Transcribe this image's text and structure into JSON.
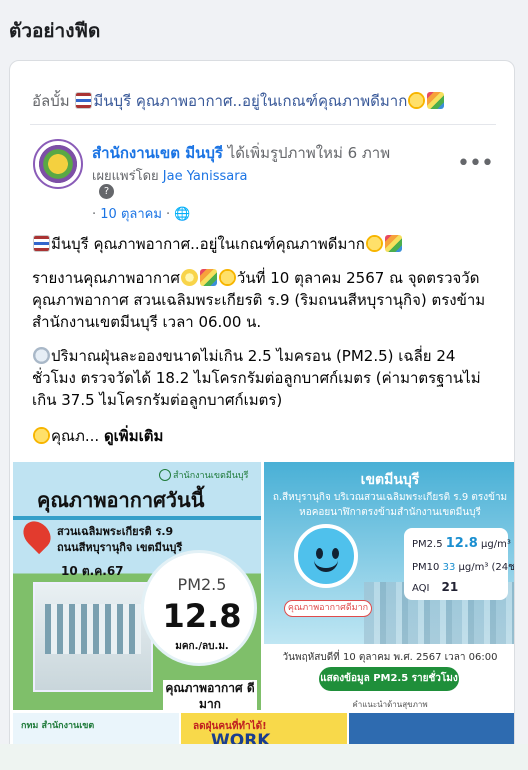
{
  "section_title": "ตัวอย่างฟีด",
  "album": {
    "prefix": "อัลบั้ม",
    "title": "มีนบุรี คุณภาพอากาศ..อยู่ในเกณฑ์คุณภาพดีมาก"
  },
  "post": {
    "author": "สำนักงานเขต มีนบุรี",
    "action": "ได้เพิ่มรูปภาพใหม่ 6 ภาพ",
    "shared_by_label": "เผยแพร่โดย",
    "shared_by_name": "Jae Yanissara",
    "question_mark": "?",
    "date": "10 ตุลาคม",
    "more_label": "•••",
    "headline": "มีนบุรี คุณภาพอากาศ..อยู่ในเกณฑ์คุณภาพดีมาก",
    "report_prefix": "รายงานคุณภาพอากาศ",
    "report_text": "วันที่ 10 ตุลาคม 2567 ณ จุดตรวจวัดคุณภาพอากาศ สวนเฉลิมพระเกียรติ ร.9 (ริมถนนสีหบุรานุกิจ) ตรงข้ามสำนักงานเขตมีนบุรี เวลา 06.00 น.",
    "pm_text": "ปริมาณฝุ่นละอองขนาดไม่เกิน 2.5 ไมครอน (PM2.5) เฉลี่ย 24 ชั่วโมง ตรวจวัดได้ 18.2 ไมโครกรัมต่อลูกบาศก์เมตร (ค่ามาตรฐานไม่เกิน 37.5 ไมโครกรัมต่อลูกบาศก์เมตร)",
    "truncated": "คุณภ...",
    "see_more": "ดูเพิ่มเติม"
  },
  "image_left": {
    "logo_text": "สำนักงานเขตมีนบุรี",
    "title": "คุณภาพอากาศวันนี้",
    "place_line1": "สวนเฉลิมพระเกียรติ ร.9",
    "place_line2": "ถนนสีหบุรานุกิจ เขตมีนบุรี",
    "date": "10 ต.ค.67",
    "pm_label": "PM2.5",
    "pm_value": "12.8",
    "unit": "มคก./ลบ.ม.",
    "status": "คุณภาพอากาศ ดีมาก"
  },
  "image_right": {
    "district": "เขตมีนบุรี",
    "location": "ถ.สีหบุรานุกิจ บริเวณสวนเฉลิมพระเกียรติ ร.9 ตรงข้ามหอคอยนาฬิกาตรงข้ามสำนักงานเขตมีนบุรี",
    "pm25_label": "PM2.5",
    "pm25_value": "12.8",
    "pm25_unit": "μg/m³",
    "pm10_label": "PM10",
    "pm10_value": "33",
    "pm10_unit": "μg/m³ (24ชม)",
    "aqi_label": "AQI",
    "aqi_value": "21",
    "status_badge": "คุณภาพอากาศดีมาก",
    "datetime": "วันพฤหัสบดีที่ 10 ตุลาคม พ.ศ. 2567 เวลา 06:00",
    "button": "แสดงข้อมูล PM2.5 รายชั่วโมง",
    "footer": "คำแนะนำด้านสุขภาพ"
  },
  "thumbs": {
    "t1_label": "กทม สำนักงานเขต",
    "t2_label": "ลดฝุ่นคนที่ทำได้!",
    "t2_big": "WORK"
  },
  "colors": {
    "link_blue": "#1b74e4",
    "muted_gray": "#65676b",
    "page_bg": "#f0f2f5"
  }
}
